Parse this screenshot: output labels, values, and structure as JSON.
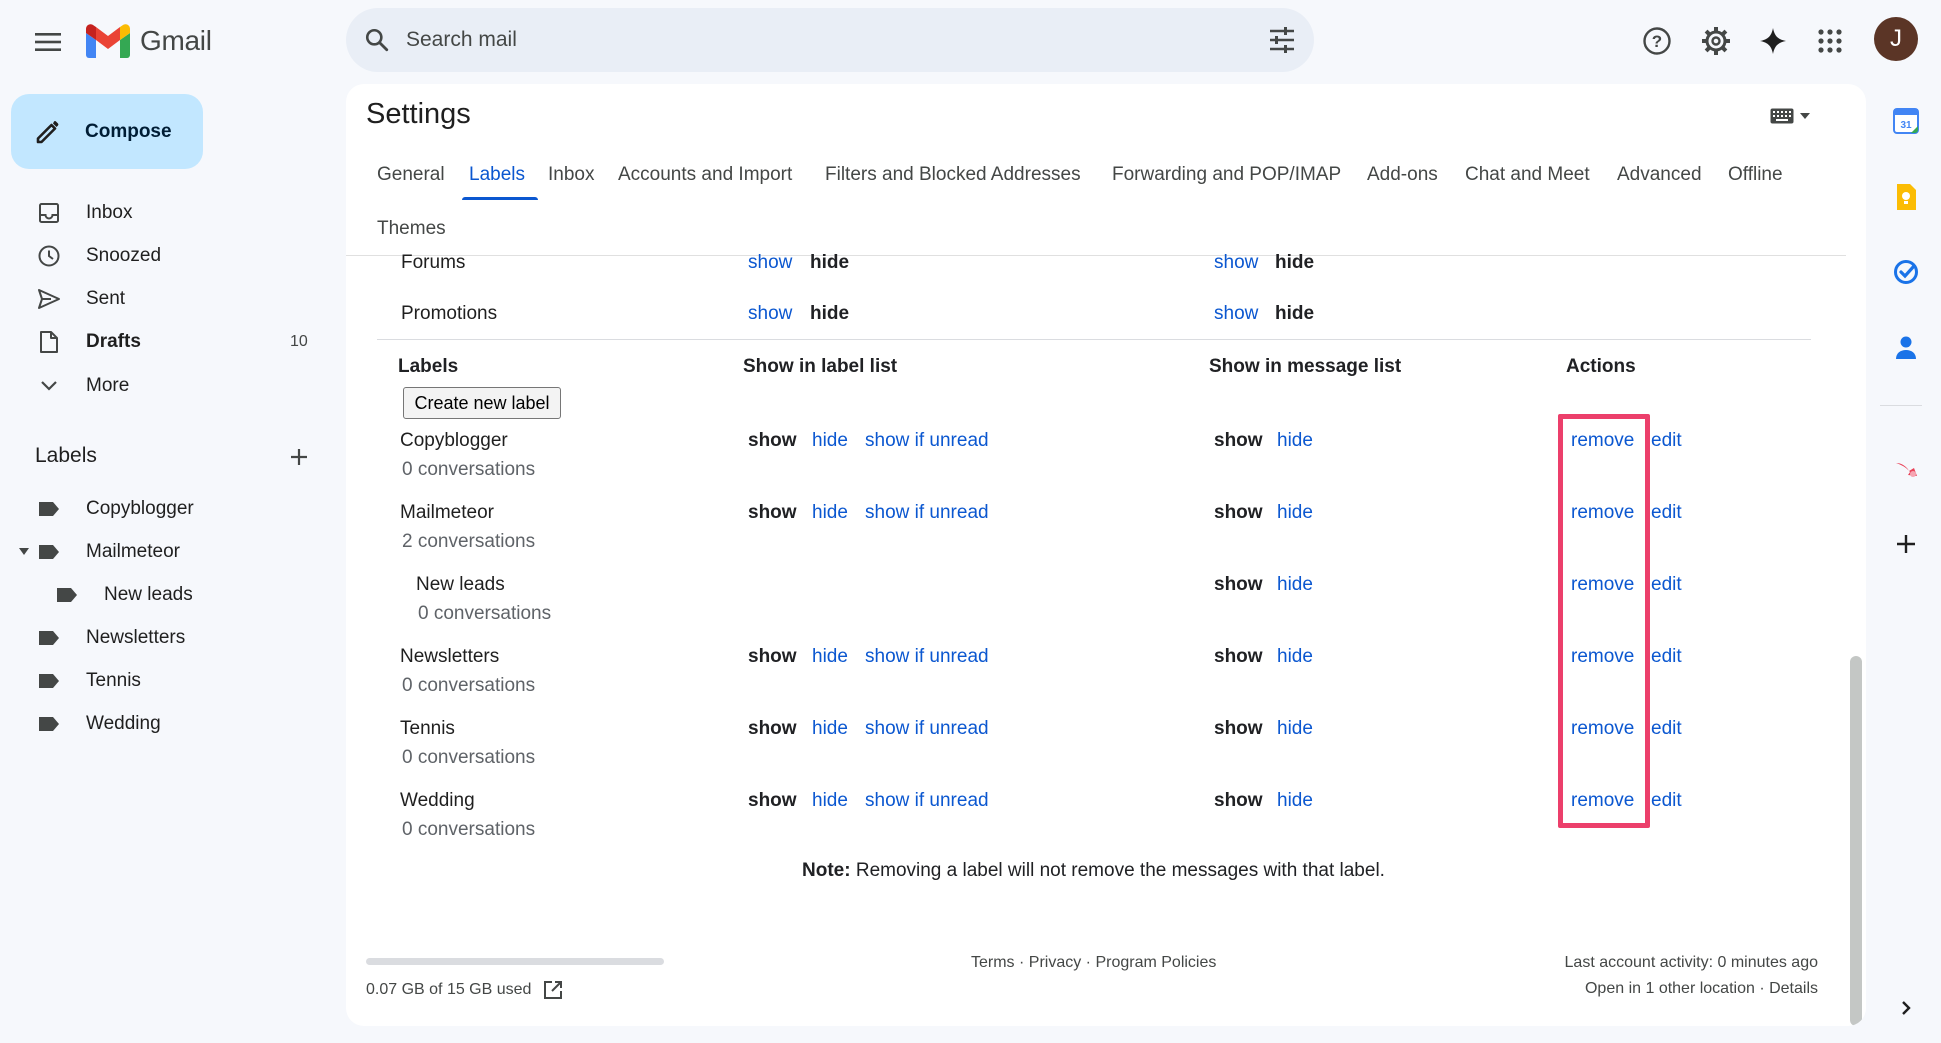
{
  "app": {
    "logo_text": "Gmail",
    "avatar_initial": "J"
  },
  "search": {
    "placeholder": "Search mail"
  },
  "compose": {
    "label": "Compose"
  },
  "nav": [
    {
      "label": "Inbox",
      "icon": "inbox-icon"
    },
    {
      "label": "Snoozed",
      "icon": "clock-icon"
    },
    {
      "label": "Sent",
      "icon": "send-icon"
    },
    {
      "label": "Drafts",
      "icon": "draft-icon",
      "count": "10"
    },
    {
      "label": "More",
      "icon": "chevron-down-icon"
    }
  ],
  "sidebar_labels": {
    "header": "Labels",
    "items": [
      "Copyblogger",
      "Mailmeteor",
      "New leads",
      "Newsletters",
      "Tennis",
      "Wedding"
    ]
  },
  "settings": {
    "title": "Settings",
    "tabs": [
      "General",
      "Labels",
      "Inbox",
      "Accounts and Import",
      "Filters and Blocked Addresses",
      "Forwarding and POP/IMAP",
      "Add-ons",
      "Chat and Meet",
      "Advanced",
      "Offline",
      "Themes"
    ],
    "active_tab": "Labels"
  },
  "categories": [
    {
      "name": "Forums"
    },
    {
      "name": "Promotions"
    }
  ],
  "labels_table": {
    "headers": {
      "labels": "Labels",
      "show_in_label_list": "Show in label list",
      "show_in_message_list": "Show in message list",
      "actions": "Actions"
    },
    "create_button": "Create new label",
    "words": {
      "show": "show",
      "hide": "hide",
      "show_if_unread": "show if unread",
      "remove": "remove",
      "edit": "edit"
    },
    "rows": [
      {
        "name": "Copyblogger",
        "conversations": "0 conversations"
      },
      {
        "name": "Mailmeteor",
        "conversations": "2 conversations"
      },
      {
        "name": "New leads",
        "conversations": "0 conversations"
      },
      {
        "name": "Newsletters",
        "conversations": "0 conversations"
      },
      {
        "name": "Tennis",
        "conversations": "0 conversations"
      },
      {
        "name": "Wedding",
        "conversations": "0 conversations"
      }
    ],
    "note_bold": "Note:",
    "note_text": " Removing a label will not remove the messages with that label."
  },
  "footer": {
    "storage": "0.07 GB of 15 GB used",
    "links": "Terms · Privacy · Program Policies",
    "activity": "Last account activity: 0 minutes ago",
    "location": "Open in 1 other location · Details",
    "storage_used_fraction": 0.005
  },
  "colors": {
    "accent": "#0b57d0",
    "compose_bg": "#c2e7ff",
    "highlight": "#ec3f6b"
  }
}
